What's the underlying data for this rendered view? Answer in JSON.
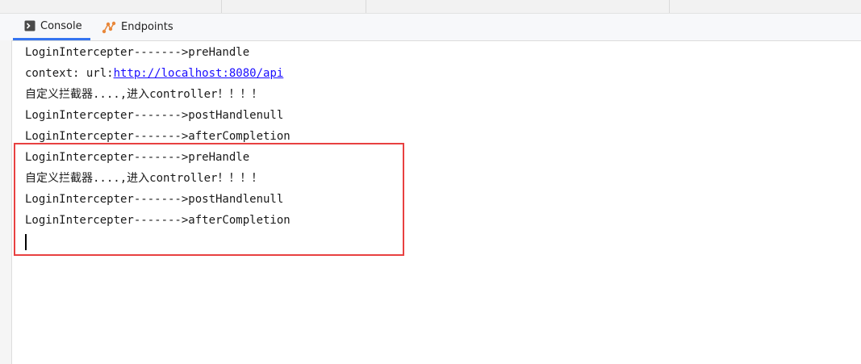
{
  "tabs": [
    {
      "label": "Console",
      "icon": "console-icon",
      "active": true
    },
    {
      "label": "Endpoints",
      "icon": "endpoints-icon",
      "active": false
    }
  ],
  "console": {
    "lines": [
      {
        "text": "LoginIntercepter------->preHandle"
      },
      {
        "text": "context: url:",
        "link": "http://localhost:8080/api"
      },
      {
        "text": "自定义拦截器....,进入controller！！！！"
      },
      {
        "text": "LoginIntercepter------->postHandlenull"
      },
      {
        "text": "LoginIntercepter------->afterCompletion"
      },
      {
        "text": "LoginIntercepter------->preHandle"
      },
      {
        "text": "自定义拦截器....,进入controller！！！！"
      },
      {
        "text": "LoginIntercepter------->postHandlenull"
      },
      {
        "text": "LoginIntercepter------->afterCompletion"
      }
    ]
  },
  "colors": {
    "accent": "#3574f0",
    "highlight_border": "#e84141",
    "link": "#1a0dff"
  }
}
